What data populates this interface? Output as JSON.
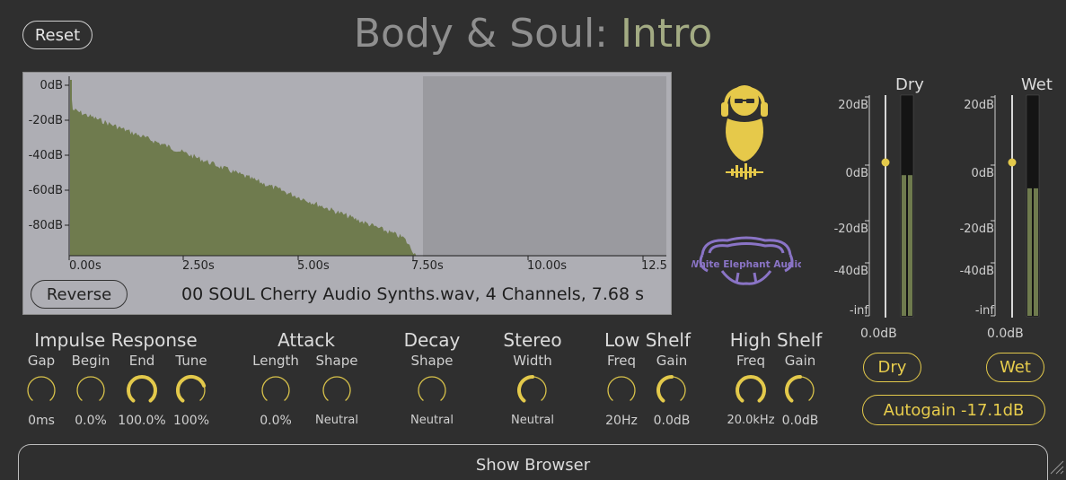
{
  "header": {
    "reset_label": "Reset",
    "title_part1": "Body & Soul: ",
    "title_part2": "Intro"
  },
  "impulse_display": {
    "db_ticks": [
      "0dB",
      "-20dB",
      "-40dB",
      "-60dB",
      "-80dB"
    ],
    "time_ticks": [
      "0.00s",
      "2.50s",
      "5.00s",
      "7.50s",
      "10.00s",
      "12.5"
    ],
    "file_info": "00 SOUL Cherry Audio Synths.wav, 4 Channels, 7.68 s",
    "reverse_label": "Reverse"
  },
  "branding": {
    "company": "White Elephant Audio"
  },
  "sections": {
    "impulse_response": {
      "title": "Impulse Response",
      "controls": [
        {
          "label": "Gap",
          "value": "0ms",
          "level": 0.0
        },
        {
          "label": "Begin",
          "value": "0.0%",
          "level": 0.0
        },
        {
          "label": "End",
          "value": "100.0%",
          "level": 1.0
        },
        {
          "label": "Tune",
          "value": "100%",
          "level": 0.75
        }
      ]
    },
    "attack": {
      "title": "Attack",
      "controls": [
        {
          "label": "Length",
          "value": "0.0%",
          "level": 0.0
        },
        {
          "label": "Shape",
          "value": "Neutral",
          "level": 0.0
        }
      ]
    },
    "decay": {
      "title": "Decay",
      "controls": [
        {
          "label": "Shape",
          "value": "Neutral",
          "level": 0.0
        }
      ]
    },
    "stereo": {
      "title": "Stereo",
      "controls": [
        {
          "label": "Width",
          "value": "Neutral",
          "level": 0.5
        }
      ]
    },
    "low_shelf": {
      "title": "Low Shelf",
      "controls": [
        {
          "label": "Freq",
          "value": "20Hz",
          "level": 0.0
        },
        {
          "label": "Gain",
          "value": "0.0dB",
          "level": 0.5
        }
      ]
    },
    "high_shelf": {
      "title": "High Shelf",
      "controls": [
        {
          "label": "Freq",
          "value": "20.0kHz",
          "level": 1.0
        },
        {
          "label": "Gain",
          "value": "0.0dB",
          "level": 0.5
        }
      ]
    }
  },
  "meters": {
    "scale": [
      "20dB",
      "0dB",
      "-20dB",
      "-40dB",
      "-inf"
    ],
    "dry": {
      "title": "Dry",
      "value": "0.0dB",
      "button_label": "Dry",
      "level": 0.64
    },
    "wet": {
      "title": "Wet",
      "value": "0.0dB",
      "button_label": "Wet",
      "level": 0.58
    },
    "autogain_label": "Autogain -17.1dB"
  },
  "footer": {
    "browser_label": "Show Browser"
  },
  "colors": {
    "accent": "#e3c94b",
    "waveform": "#6f7b4e",
    "title_accent": "#a3ab83",
    "background": "#2f2f2f"
  }
}
